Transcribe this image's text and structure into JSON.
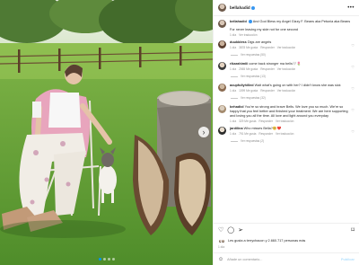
{
  "post": {
    "author": "bellahadid",
    "options_icon": "more-horizontal-icon"
  },
  "caption": {
    "username": "bellahadid",
    "text": "And God Bless my Angel Gizzy F. Beans aka Petunia aka Beans",
    "extra": "For never leaving my side not for one second",
    "time": "1 día",
    "translate": "Ver traducción"
  },
  "comments": [
    {
      "username": "duukbless",
      "text": "Digs are angels",
      "time": "1 día",
      "likes": "3878 Me gusta",
      "reply": "Responder",
      "translate": "Ver traducción",
      "replies": "Ver respuestas (50)"
    },
    {
      "username": "rikarahimiii",
      "text": "come back stronger ma bells🤍🌷",
      "time": "1 día",
      "likes": "2065 Me gusta",
      "reply": "Responder",
      "translate": "Ver traducción",
      "replies": "Ver respuestas (13)"
    },
    {
      "username": "acupfullyhilled",
      "text": "Wait what's going on with her? I didn't know she was sick",
      "time": "1 día",
      "likes": "1099 Me gusta",
      "reply": "Responder",
      "translate": "Ver traducción",
      "replies": "Ver respuestas (32)"
    },
    {
      "username": "behadiol",
      "text": "You're so strong and brave Bells. We love you so much. We're so happy that you feel better and finished your treatment. We are here supporting and loving you all the time. All love and light around you everyday",
      "time": "1 día",
      "likes": "329 Me gusta",
      "reply": "Responder",
      "translate": "Ver traducción",
      "replies": ""
    },
    {
      "username": "jardilina",
      "text": "Who misses Bella?🥺❤️",
      "time": "1 día",
      "likes": "791 Me gusta",
      "reply": "Responder",
      "translate": "Ver traducción",
      "replies": "Ver respuestas (2)"
    }
  ],
  "actions": {
    "like_icon": "heart-outline-icon",
    "comment_icon": "comment-bubble-icon",
    "share_icon": "paper-plane-icon",
    "save_icon": "bookmark-icon"
  },
  "likes_text": "Les gusta a terrychacon y 2.660.717 personas más",
  "post_date": "1 día",
  "add_comment": {
    "emoji_icon": "smiley-icon",
    "placeholder": "Añade un comentario...",
    "publish": "Publicar"
  },
  "carousel": {
    "next_icon": "chevron-right-icon",
    "slides": 4,
    "active": 0
  },
  "colors": {
    "accent": "#0095f6",
    "muted": "#8e8e8e",
    "border": "#efefef"
  }
}
